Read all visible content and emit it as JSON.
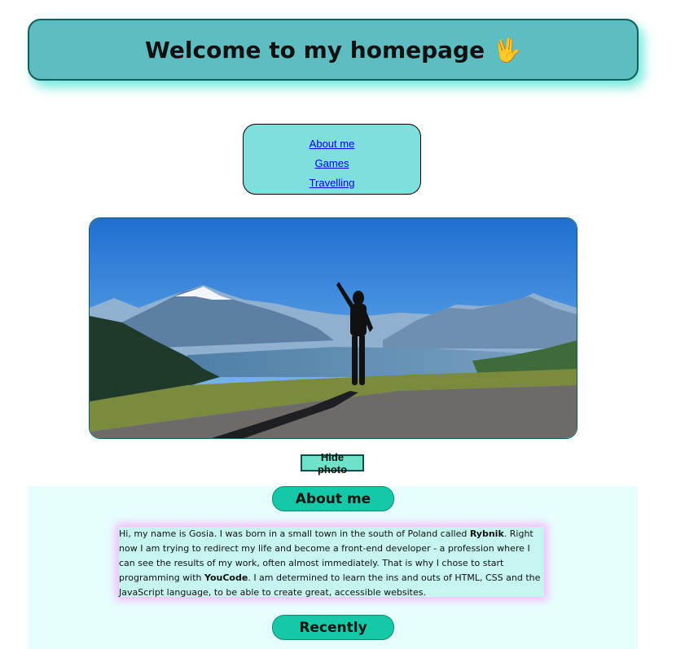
{
  "header": {
    "title": "Welcome to my homepage",
    "emoji_icon": "vulcan-salute-icon"
  },
  "nav": {
    "links": [
      "About me",
      "Games",
      "Travelling"
    ]
  },
  "photo": {
    "description_icon": "photo-mountain-lake-selfie"
  },
  "buttons": {
    "hide_photo": "Hide photo"
  },
  "about": {
    "heading": "About me",
    "text_1": "Hi, my name is Gosia. I was born in a small town in the south of Poland called ",
    "bold_1": "Rybnik",
    "text_2": ". Right now I am trying to redirect my life and become a front-end developer - a profession where I can see the results of my work, often almost immediately. That is why I chose to start programming with ",
    "bold_2": "YouCode",
    "text_3": ". I am determined to learn the ins and outs of HTML, CSS and the JavaScript language, to be able to create great, accessible websites."
  },
  "recently": {
    "heading": "Recently"
  },
  "colors": {
    "header_bg": "#5dbdc1",
    "nav_bg": "#7edfdc",
    "pill_bg": "#15c9a8",
    "section_bg": "#e6fffd",
    "link": "#0000ee"
  }
}
